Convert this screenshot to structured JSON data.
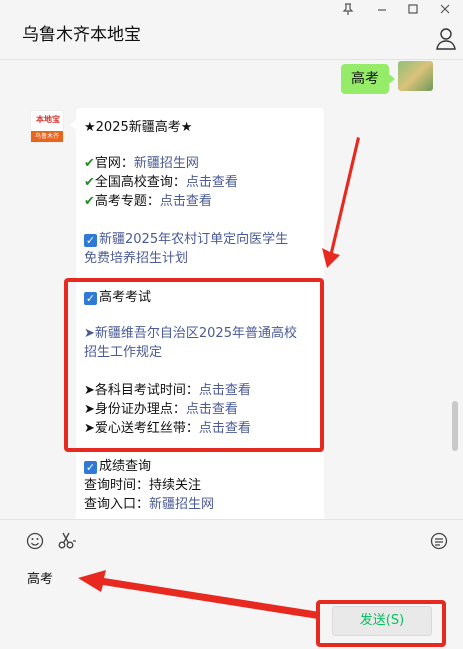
{
  "window": {
    "title": "乌鲁木齐本地宝",
    "pin_icon": "pin-icon",
    "minimize_icon": "minimize-icon",
    "maximize_icon": "maximize-icon",
    "close_icon": "close-icon"
  },
  "sent_message": {
    "text": "高考"
  },
  "bot": {
    "avatar_brand": "本地宝",
    "avatar_city": "乌鲁木齐"
  },
  "message": {
    "headline": "★2025新疆高考★",
    "official_label": "官网：",
    "official_link": "新疆招生网",
    "schools_label": "全国高校查询：",
    "schools_link": "点击查看",
    "topic_label": "高考专题：",
    "topic_link": "点击查看",
    "plan_line1": "新疆2025年农村订单定向医学生",
    "plan_line2": "免费培养招生计划",
    "exam_title": "高考考试",
    "rules_line1": "➤新疆维吾尔自治区2025年普通高校",
    "rules_line2": "招生工作规定",
    "time_label": "➤各科目考试时间：",
    "time_link": "点击查看",
    "id_label": "➤身份证办理点：",
    "id_link": "点击查看",
    "ribbon_label": "➤爱心送考红丝带：",
    "ribbon_link": "点击查看",
    "score_title": "成绩查询",
    "score_time": "查询时间：持续关注",
    "score_entry_label": "查询入口：",
    "score_entry_link": "新疆招生网"
  },
  "input": {
    "draft_text": "高考",
    "send_label": "发送(S)"
  },
  "colors": {
    "accent_green": "#95ec69",
    "send_text": "#07c160",
    "highlight_red": "#e8291f",
    "link": "#4a5a95"
  }
}
